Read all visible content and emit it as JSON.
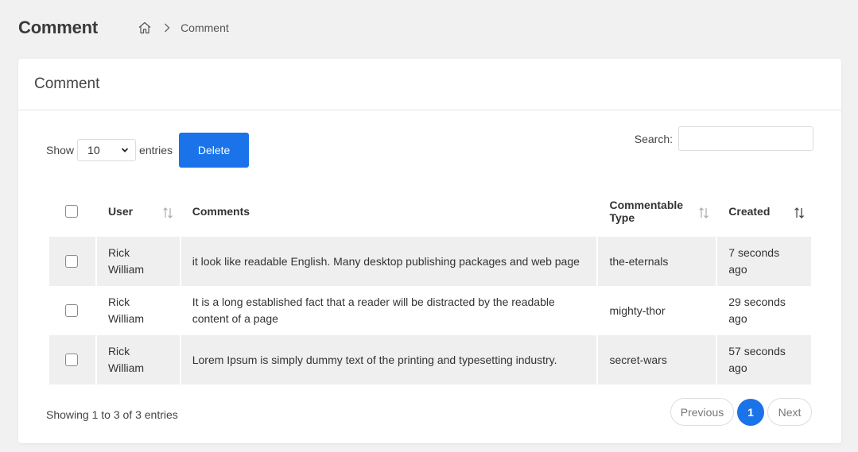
{
  "page": {
    "title": "Comment"
  },
  "breadcrumb": {
    "home_icon": "home-icon",
    "current": "Comment"
  },
  "card": {
    "title": "Comment"
  },
  "length": {
    "show_label": "Show",
    "value": "10",
    "entries_label": "entries"
  },
  "toolbar": {
    "delete_label": "Delete"
  },
  "search": {
    "label": "Search:",
    "value": ""
  },
  "table": {
    "headers": {
      "user": "User",
      "comments": "Comments",
      "type_line1": "Commentable",
      "type_line2": "Type",
      "created": "Created"
    },
    "rows": [
      {
        "user": "Rick William",
        "comment": "it look like readable English. Many desktop publishing packages and web page",
        "type": "the-eternals",
        "created": "7 seconds ago"
      },
      {
        "user": "Rick William",
        "comment": "It is a long established fact that a reader will be distracted by the readable content of a page",
        "type": "mighty-thor",
        "created": "29 seconds ago"
      },
      {
        "user": "Rick William",
        "comment": "Lorem Ipsum is simply dummy text of the printing and typesetting industry.",
        "type": "secret-wars",
        "created": "57 seconds ago"
      }
    ]
  },
  "footer": {
    "info": "Showing 1 to 3 of 3 entries"
  },
  "pagination": {
    "previous": "Previous",
    "page": "1",
    "next": "Next"
  },
  "colors": {
    "accent": "#1a73e8",
    "background": "#f1f1f1",
    "row_stripe": "#efefef"
  }
}
